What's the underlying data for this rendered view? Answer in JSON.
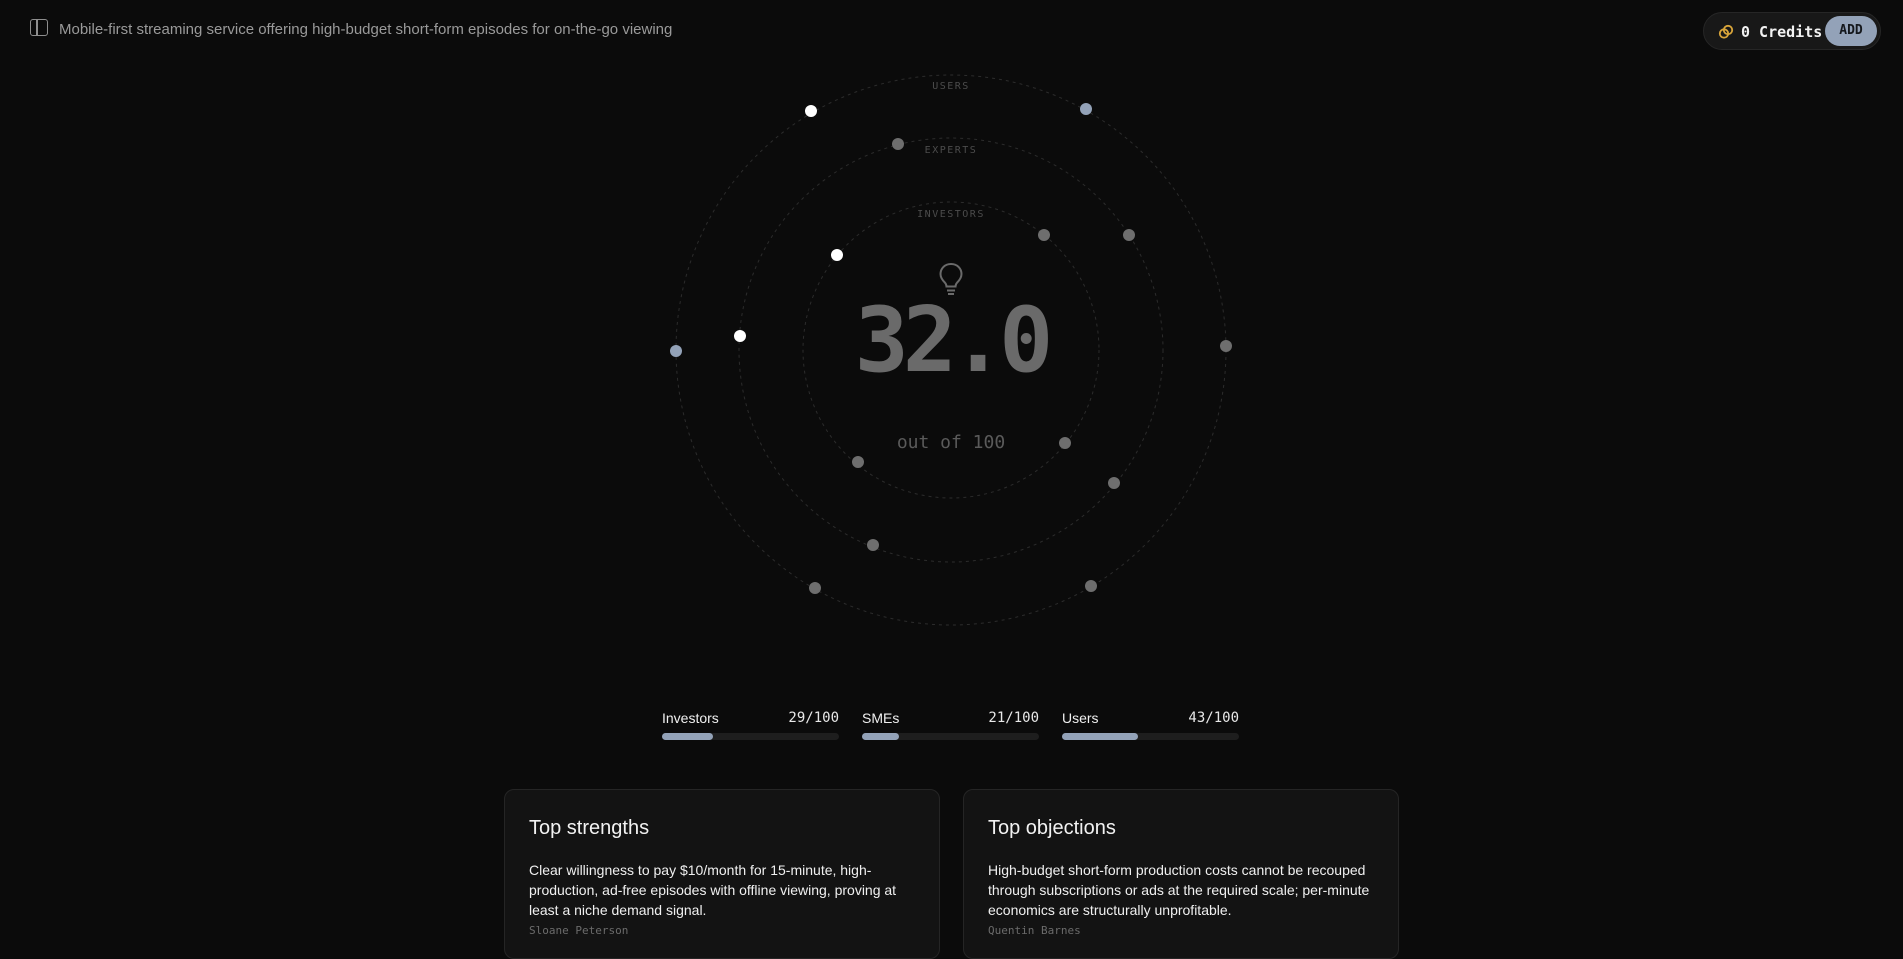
{
  "header": {
    "title": "Mobile-first streaming service offering high-budget short-form episodes for on-the-go viewing",
    "credits_label": "0 Credits",
    "add_label": "ADD"
  },
  "score": {
    "value": "32.0",
    "out_of": "out of 100"
  },
  "rings": {
    "users_label": "USERS",
    "experts_label": "EXPERTS",
    "investors_label": "INVESTORS"
  },
  "breakdown": [
    {
      "label": "Investors",
      "value": "29/100",
      "fraction": 0.29
    },
    {
      "label": "SMEs",
      "value": "21/100",
      "fraction": 0.21
    },
    {
      "label": "Users",
      "value": "43/100",
      "fraction": 0.43
    }
  ],
  "strengths": {
    "title": "Top strengths",
    "text": "Clear willingness to pay $10/month for 15-minute, high-production, ad-free episodes with offline viewing, proving at least a niche demand signal.",
    "author": "Sloane Peterson"
  },
  "objections": {
    "title": "Top objections",
    "text": "High-budget short-form production costs cannot be recouped through subscriptions or ads at the required scale; per-minute economics are structurally unprofitable.",
    "author": "Quentin Barnes"
  },
  "colors": {
    "accent": "#93a2b8",
    "dot_white": "#ffffff",
    "dot_gray": "#6e6e6e",
    "coin": "#d9a53a"
  }
}
